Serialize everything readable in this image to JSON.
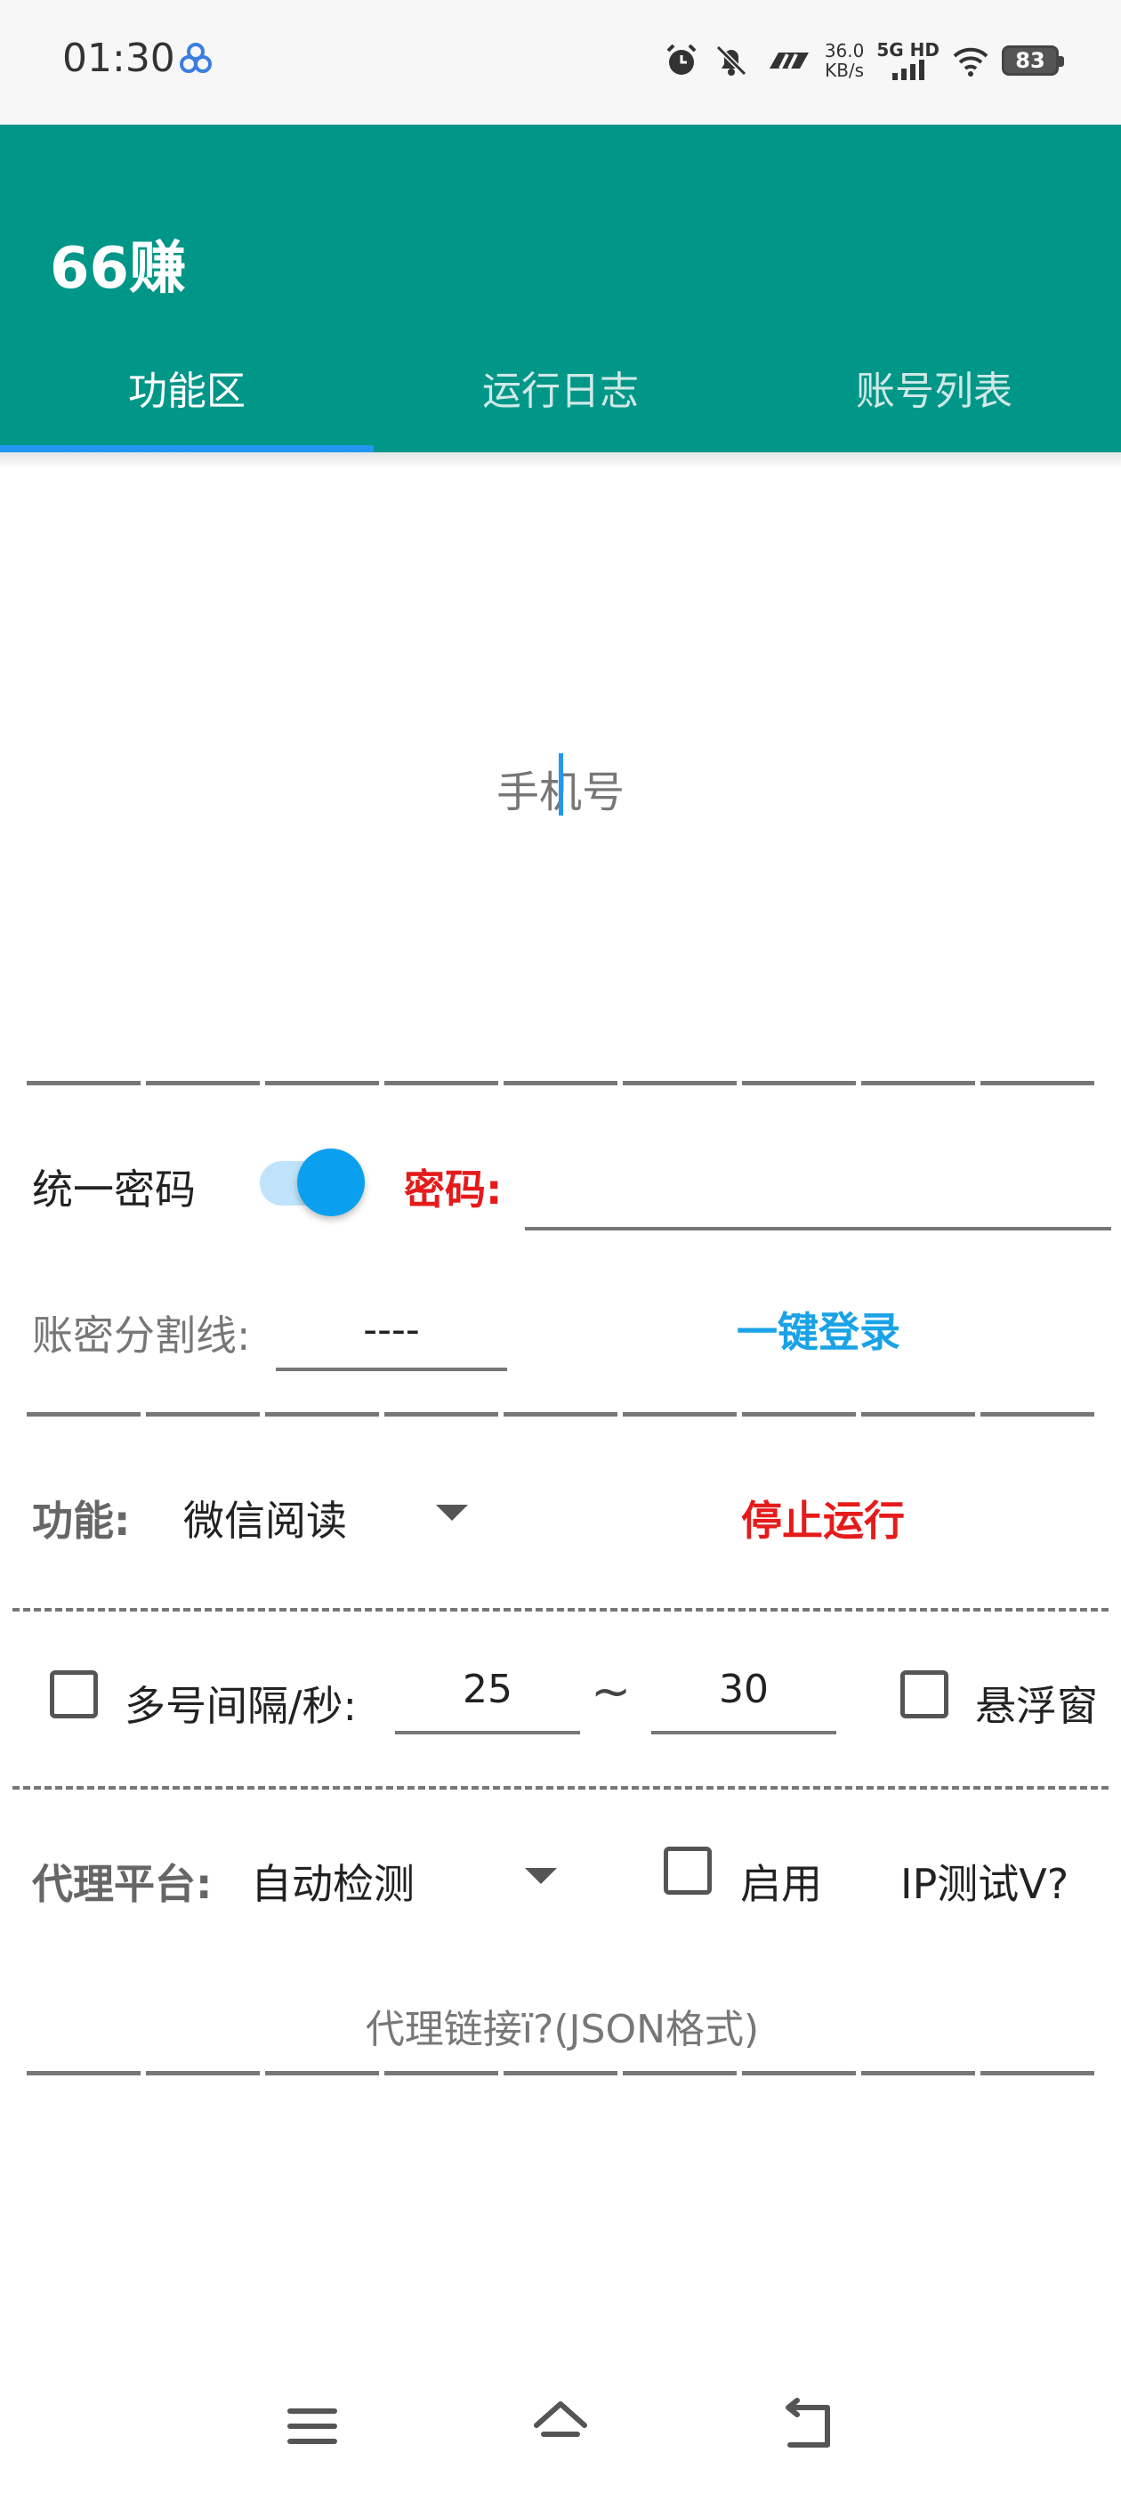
{
  "status_bar": {
    "time": "01:30",
    "net_speed_value": "36.0",
    "net_speed_unit": "KB/s",
    "network_label": "5G HD",
    "battery": "83"
  },
  "app_bar": {
    "title": "66赚",
    "tabs": [
      {
        "label": "功能区",
        "selected": true
      },
      {
        "label": "运行日志",
        "selected": false
      },
      {
        "label": "账号列表",
        "selected": false
      }
    ],
    "colors": {
      "background": "#009688",
      "indicator": "#2196f3"
    }
  },
  "form": {
    "phone_placeholder": "手机号",
    "unify_password_label": "统一密码",
    "unify_password_on": true,
    "password_label": "密码:",
    "password_value": "",
    "separator_label": "账密分割线:",
    "separator_value": "----",
    "login_button": "一键登录",
    "function_label": "功能:",
    "function_value": "微信阅读",
    "stop_button": "停止运行",
    "interval_label": "多号间隔/秒:",
    "interval_min": "25",
    "interval_separator": "~",
    "interval_max": "30",
    "multi_checked": false,
    "float_window_label": "悬浮窗",
    "float_window_checked": false,
    "proxy_platform_label": "代理平台:",
    "proxy_platform_value": "自动检测",
    "enable_label": "启用",
    "enable_checked": false,
    "ip_test_label": "IP测试V?",
    "proxy_link_placeholder": "代理链接ї?(JSON格式)"
  },
  "colors": {
    "accent": "#2196f3",
    "danger": "#e51b1b",
    "link": "#1aa2e6"
  }
}
